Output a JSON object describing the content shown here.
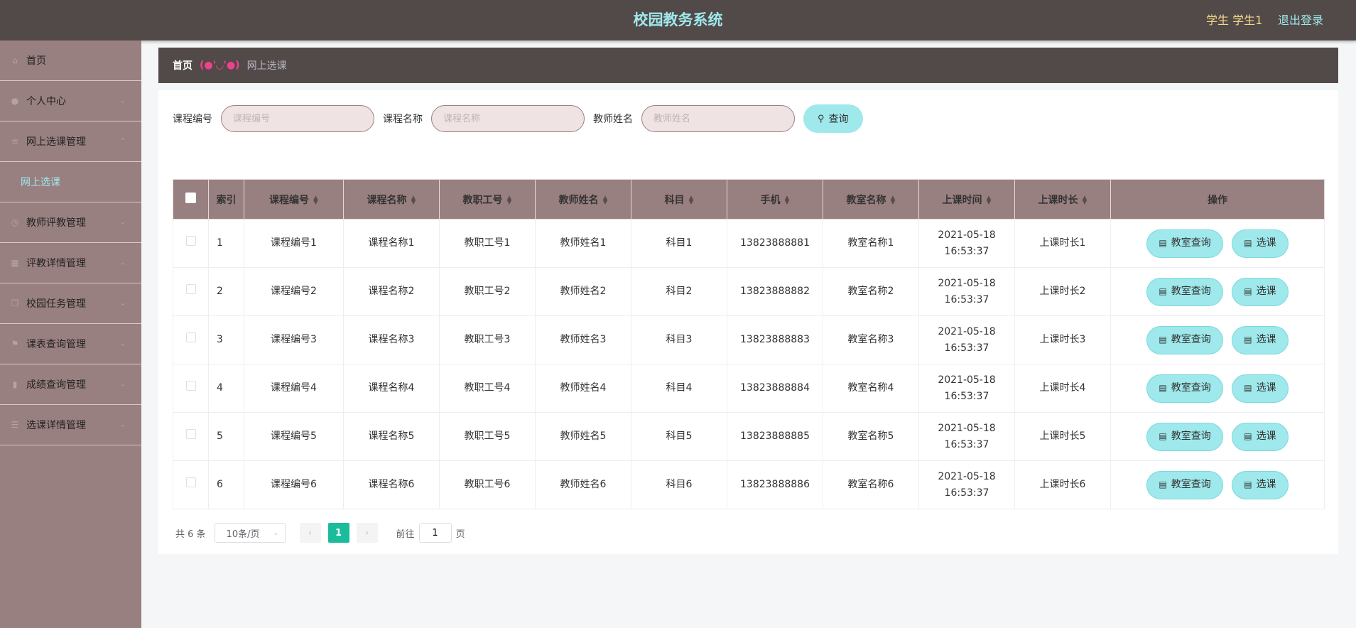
{
  "header": {
    "title": "校园教务系统",
    "user": "学生 学生1",
    "logout": "退出登录"
  },
  "sidebar": {
    "items": [
      {
        "label": "首页",
        "icon": "home-icon",
        "glyph": "⌂"
      },
      {
        "label": "个人中心",
        "icon": "user-icon",
        "glyph": "●"
      },
      {
        "label": "网上选课管理",
        "icon": "list-icon",
        "glyph": "≡"
      },
      {
        "label": "教师评教管理",
        "icon": "clock-icon",
        "glyph": "◷"
      },
      {
        "label": "评教详情管理",
        "icon": "grid-icon",
        "glyph": "▦"
      },
      {
        "label": "校园任务管理",
        "icon": "copy-icon",
        "glyph": "❐"
      },
      {
        "label": "课表查询管理",
        "icon": "flag-icon",
        "glyph": "⚑"
      },
      {
        "label": "成绩查询管理",
        "icon": "chart-icon",
        "glyph": "▮"
      },
      {
        "label": "选课详情管理",
        "icon": "menu-icon",
        "glyph": "☰"
      }
    ],
    "sub_item": "网上选课"
  },
  "breadcrumb": {
    "home": "首页",
    "separator": "(●'◡'●)",
    "current": "网上选课"
  },
  "search": {
    "fields": [
      {
        "label": "课程编号",
        "placeholder": "课程编号"
      },
      {
        "label": "课程名称",
        "placeholder": "课程名称"
      },
      {
        "label": "教师姓名",
        "placeholder": "教师姓名"
      }
    ],
    "button": "查询"
  },
  "table": {
    "headers": [
      "索引",
      "课程编号",
      "课程名称",
      "教职工号",
      "教师姓名",
      "科目",
      "手机",
      "教室名称",
      "上课时间",
      "上课时长",
      "操作"
    ],
    "rows": [
      {
        "index": "1",
        "course_no": "课程编号1",
        "course_name": "课程名称1",
        "staff_no": "教职工号1",
        "teacher": "教师姓名1",
        "subject": "科目1",
        "phone": "13823888881",
        "room": "教室名称1",
        "time": "2021-05-18 16:53:37",
        "duration": "上课时长1"
      },
      {
        "index": "2",
        "course_no": "课程编号2",
        "course_name": "课程名称2",
        "staff_no": "教职工号2",
        "teacher": "教师姓名2",
        "subject": "科目2",
        "phone": "13823888882",
        "room": "教室名称2",
        "time": "2021-05-18 16:53:37",
        "duration": "上课时长2"
      },
      {
        "index": "3",
        "course_no": "课程编号3",
        "course_name": "课程名称3",
        "staff_no": "教职工号3",
        "teacher": "教师姓名3",
        "subject": "科目3",
        "phone": "13823888883",
        "room": "教室名称3",
        "time": "2021-05-18 16:53:37",
        "duration": "上课时长3"
      },
      {
        "index": "4",
        "course_no": "课程编号4",
        "course_name": "课程名称4",
        "staff_no": "教职工号4",
        "teacher": "教师姓名4",
        "subject": "科目4",
        "phone": "13823888884",
        "room": "教室名称4",
        "time": "2021-05-18 16:53:37",
        "duration": "上课时长4"
      },
      {
        "index": "5",
        "course_no": "课程编号5",
        "course_name": "课程名称5",
        "staff_no": "教职工号5",
        "teacher": "教师姓名5",
        "subject": "科目5",
        "phone": "13823888885",
        "room": "教室名称5",
        "time": "2021-05-18 16:53:37",
        "duration": "上课时长5"
      },
      {
        "index": "6",
        "course_no": "课程编号6",
        "course_name": "课程名称6",
        "staff_no": "教职工号6",
        "teacher": "教师姓名6",
        "subject": "科目6",
        "phone": "13823888886",
        "room": "教室名称6",
        "time": "2021-05-18 16:53:37",
        "duration": "上课时长6"
      }
    ],
    "actions": {
      "room_query": "教室查询",
      "select": "选课"
    }
  },
  "pagination": {
    "total": "共 6 条",
    "page_size": "10条/页",
    "current_page": "1",
    "goto_prefix": "前往",
    "goto_value": "1",
    "goto_suffix": "页"
  },
  "colors": {
    "header_bg": "#524949",
    "sidebar_bg": "#998080",
    "accent": "#9fe8eb",
    "user_text": "#f3d98a",
    "page_active": "#1abc9c"
  }
}
